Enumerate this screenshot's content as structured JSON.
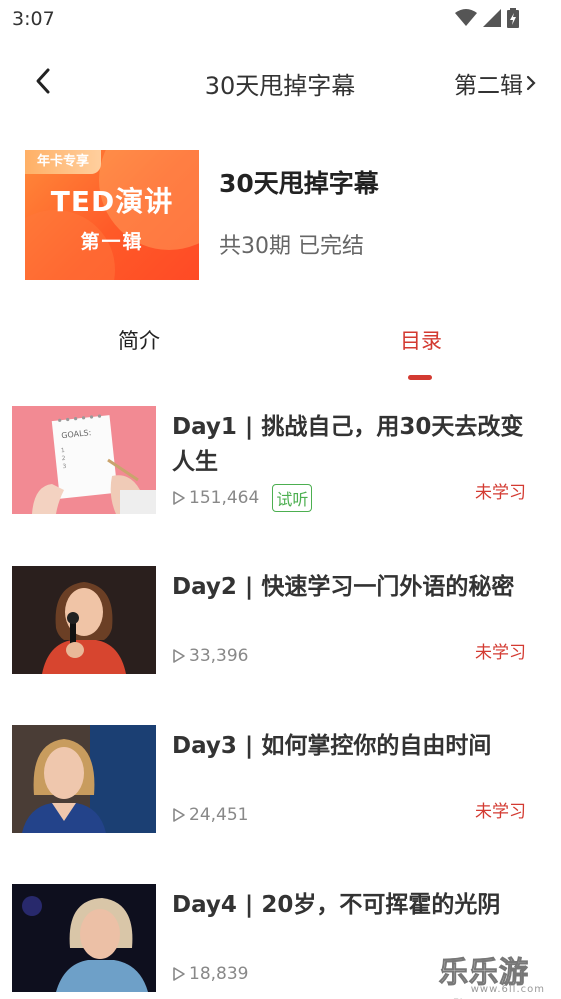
{
  "status_bar": {
    "time": "3:07"
  },
  "nav": {
    "title": "30天甩掉字幕",
    "next_label": "第二辑"
  },
  "album": {
    "cover_badge": "年卡专享",
    "cover_title": "TED演讲",
    "cover_subtitle": "第一辑",
    "title": "30天甩掉字幕",
    "meta": "共30期 已完结"
  },
  "tabs": [
    {
      "label": "简介",
      "active": false
    },
    {
      "label": "目录",
      "active": true
    }
  ],
  "episodes": [
    {
      "title": "Day1 | 挑战自己，用30天去改变人生",
      "plays": "151,464",
      "badge": "试听",
      "status": "未学习",
      "thumb": "goals-notebook"
    },
    {
      "title": "Day2 | 快速学习一门外语的秘密",
      "plays": "33,396",
      "badge": "",
      "status": "未学习",
      "thumb": "speaker-woman-red-top"
    },
    {
      "title": "Day3 | 如何掌控你的自由时间",
      "plays": "24,451",
      "badge": "",
      "status": "未学习",
      "thumb": "speaker-woman-blue-top"
    },
    {
      "title": "Day4 | 20岁，不可挥霍的光阴",
      "plays": "18,839",
      "badge": "",
      "status": "",
      "thumb": "speaker-woman-blonde"
    }
  ],
  "watermark": {
    "main": "乐乐游戏",
    "sub": "www.6ll.com"
  },
  "colors": {
    "accent": "#d33a31",
    "trial": "#4caf50",
    "cover_orange": "#ff5a28"
  }
}
